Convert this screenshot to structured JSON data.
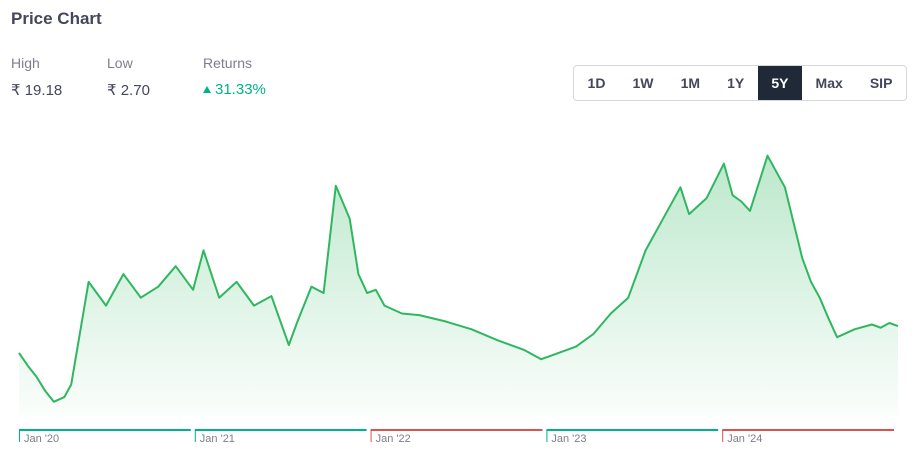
{
  "header": {
    "title": "Price Chart"
  },
  "stats": [
    {
      "label": "High",
      "value": "₹ 19.18"
    },
    {
      "label": "Low",
      "value": "₹ 2.70"
    },
    {
      "label": "Returns",
      "value": "31.33%"
    }
  ],
  "ranges": {
    "items": [
      "1D",
      "1W",
      "1M",
      "1Y",
      "5Y",
      "Max",
      "SIP"
    ],
    "active": "5Y"
  },
  "colors": {
    "up": "#00b386",
    "down": "#d9534f",
    "line": "#2fb75f"
  },
  "chart_data": {
    "type": "area",
    "x_axis_labels": [
      {
        "label": "Jan '20",
        "trend": "up"
      },
      {
        "label": "Jan '21",
        "trend": "up"
      },
      {
        "label": "Jan '22",
        "trend": "down"
      },
      {
        "label": "Jan '23",
        "trend": "up"
      },
      {
        "label": "Jan '24",
        "trend": "down"
      }
    ],
    "x_range": [
      2019.9,
      2024.95
    ],
    "ylim": [
      2.7,
      19.18
    ],
    "series": [
      {
        "x": [
          2019.9,
          2019.95,
          2020.0,
          2020.05,
          2020.1,
          2020.16,
          2020.2,
          2020.3,
          2020.4,
          2020.5,
          2020.6,
          2020.7,
          2020.8,
          2020.9,
          2020.96,
          2021.05,
          2021.15,
          2021.25,
          2021.35,
          2021.45,
          2021.5,
          2021.58,
          2021.65,
          2021.72,
          2021.8,
          2021.85,
          2021.9,
          2021.95,
          2022.0,
          2022.1,
          2022.2,
          2022.35,
          2022.5,
          2022.65,
          2022.8,
          2022.9,
          2023.0,
          2023.1,
          2023.2,
          2023.3,
          2023.4,
          2023.5,
          2023.6,
          2023.7,
          2023.75,
          2023.85,
          2023.95,
          2024.0,
          2024.05,
          2024.1,
          2024.2,
          2024.3,
          2024.4,
          2024.45,
          2024.5,
          2024.55,
          2024.6,
          2024.7,
          2024.8,
          2024.85,
          2024.9,
          2024.95
        ],
        "y": [
          6.0,
          5.2,
          4.5,
          3.6,
          2.9,
          3.2,
          4.0,
          10.5,
          9.0,
          11.0,
          9.5,
          10.2,
          11.5,
          10.0,
          12.5,
          9.5,
          10.5,
          9.0,
          9.6,
          6.5,
          8.0,
          10.2,
          9.8,
          16.6,
          14.5,
          11.0,
          9.8,
          10.0,
          9.0,
          8.5,
          8.4,
          8.0,
          7.5,
          6.8,
          6.2,
          5.6,
          6.0,
          6.4,
          7.2,
          8.5,
          9.5,
          12.5,
          14.5,
          16.5,
          14.8,
          15.8,
          18.0,
          16.0,
          15.6,
          15.0,
          18.5,
          16.5,
          12.0,
          10.5,
          9.5,
          8.2,
          7.0,
          7.5,
          7.8,
          7.6,
          7.9,
          7.7
        ]
      }
    ]
  }
}
